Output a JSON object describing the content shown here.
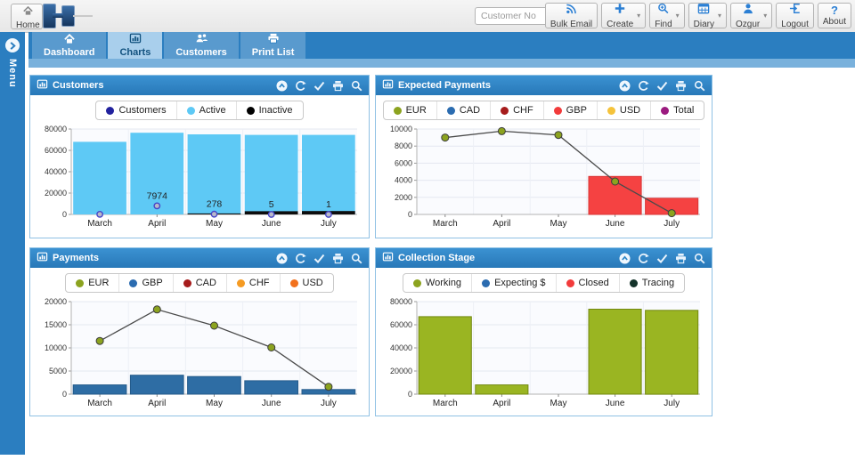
{
  "theme": {
    "bar_blue": "#2b7ec0",
    "panel_header_blue": "#2e86c6",
    "active_tab": "#a9cfec",
    "subbar": "#79b1dc",
    "button_icon_blue": "#2b7fd4"
  },
  "header": {
    "home": {
      "label": "Home"
    },
    "search": {
      "placeholder": "Customer No"
    },
    "buttons": [
      {
        "label": "Bulk Email",
        "icon": "broadcast-icon",
        "caret": false
      },
      {
        "label": "Create",
        "icon": "plus-icon",
        "caret": true
      },
      {
        "label": "Find",
        "icon": "zoom-plus-icon",
        "caret": true
      },
      {
        "label": "Diary",
        "icon": "calendar-icon",
        "caret": true
      },
      {
        "label": "Ozgur",
        "icon": "user-icon",
        "caret": true
      },
      {
        "label": "Logout",
        "icon": "logout-icon",
        "caret": false
      },
      {
        "label": "About",
        "icon": "question-icon",
        "caret": false
      }
    ]
  },
  "sidebar": {
    "label": "Menu"
  },
  "tabs": [
    {
      "label": "Dashboard",
      "icon": "home-icon",
      "active": false
    },
    {
      "label": "Charts",
      "icon": "bar-chart-icon",
      "active": true
    },
    {
      "label": "Customers",
      "icon": "users-icon",
      "active": false
    },
    {
      "label": "Print List",
      "icon": "printer-icon",
      "active": false
    }
  ],
  "panel_toolbar_icons": [
    "collapse-icon",
    "refresh-icon",
    "check-icon",
    "print-icon",
    "search-icon"
  ],
  "chart_data": [
    {
      "type": "bar",
      "title": "Customers",
      "categories": [
        "March",
        "April",
        "May",
        "June",
        "July"
      ],
      "ylim": [
        0,
        80000
      ],
      "ytick_step": 20000,
      "grid": true,
      "legend_position": "top",
      "legend": [
        {
          "name": "Customers",
          "color": "#22229e"
        },
        {
          "name": "Active",
          "color": "#5ec9f5"
        },
        {
          "name": "Inactive",
          "color": "#000000"
        }
      ],
      "series": [
        {
          "name": "Active",
          "type": "bar",
          "color": "#5ec9f5",
          "values": [
            68000,
            76500,
            75000,
            74500,
            74500
          ]
        },
        {
          "name": "Inactive",
          "type": "bar",
          "color": "#0d0d0d",
          "values": [
            0,
            0,
            900,
            3000,
            3200
          ]
        },
        {
          "name": "Customers",
          "type": "point",
          "color": "#b9b9c9",
          "border": "#4646c8",
          "values": [
            100,
            7974,
            278,
            5,
            1
          ],
          "labels": [
            "",
            "7974",
            "278",
            "5",
            "1"
          ]
        }
      ]
    },
    {
      "type": "line",
      "title": "Expected Payments",
      "categories": [
        "March",
        "April",
        "May",
        "June",
        "July"
      ],
      "ylim": [
        0,
        10000
      ],
      "ytick_step": 2000,
      "grid": true,
      "legend_position": "top",
      "legend": [
        {
          "name": "EUR",
          "color": "#8ca31f"
        },
        {
          "name": "CAD",
          "color": "#2b6cb0"
        },
        {
          "name": "CHF",
          "color": "#a61c1c"
        },
        {
          "name": "GBP",
          "color": "#f23b3b"
        },
        {
          "name": "USD",
          "color": "#f5c33b"
        },
        {
          "name": "Total",
          "color": "#9b1b7f"
        }
      ],
      "series": [
        {
          "name": "GBP",
          "type": "bar",
          "color": "#f54242",
          "border": "#d93434",
          "values": [
            0,
            0,
            0,
            4450,
            1900
          ]
        },
        {
          "name": "EUR",
          "type": "line",
          "color": "#8ca31f",
          "line_color": "#4a4a4a",
          "values": [
            9000,
            9750,
            9300,
            3850,
            150
          ]
        }
      ]
    },
    {
      "type": "line",
      "title": "Payments",
      "categories": [
        "March",
        "April",
        "May",
        "June",
        "July"
      ],
      "ylim": [
        0,
        20000
      ],
      "ytick_step": 5000,
      "grid": true,
      "legend_position": "top",
      "legend": [
        {
          "name": "EUR",
          "color": "#8ca31f"
        },
        {
          "name": "GBP",
          "color": "#2b6cb0"
        },
        {
          "name": "CAD",
          "color": "#a61c1c"
        },
        {
          "name": "CHF",
          "color": "#f59b23"
        },
        {
          "name": "USD",
          "color": "#f2711c"
        }
      ],
      "series": [
        {
          "name": "GBP",
          "type": "bar",
          "color": "#2e6da4",
          "border": "#245a8a",
          "values": [
            2000,
            4100,
            3800,
            2900,
            1000
          ]
        },
        {
          "name": "EUR",
          "type": "line",
          "color": "#8ca31f",
          "line_color": "#4a4a4a",
          "values": [
            11500,
            18300,
            14800,
            10100,
            1600
          ]
        }
      ]
    },
    {
      "type": "bar",
      "title": "Collection Stage",
      "categories": [
        "March",
        "April",
        "May",
        "June",
        "July"
      ],
      "ylim": [
        0,
        80000
      ],
      "ytick_step": 20000,
      "grid": true,
      "legend_position": "top",
      "legend": [
        {
          "name": "Working",
          "color": "#8ca31f"
        },
        {
          "name": "Expecting $",
          "color": "#2b6cb0"
        },
        {
          "name": "Closed",
          "color": "#f23b3b"
        },
        {
          "name": "Tracing",
          "color": "#14332a"
        }
      ],
      "series": [
        {
          "name": "Working",
          "type": "bar",
          "color": "#9ab522",
          "border": "#72880f",
          "values": [
            67000,
            8000,
            0,
            73500,
            72500
          ]
        }
      ]
    }
  ]
}
